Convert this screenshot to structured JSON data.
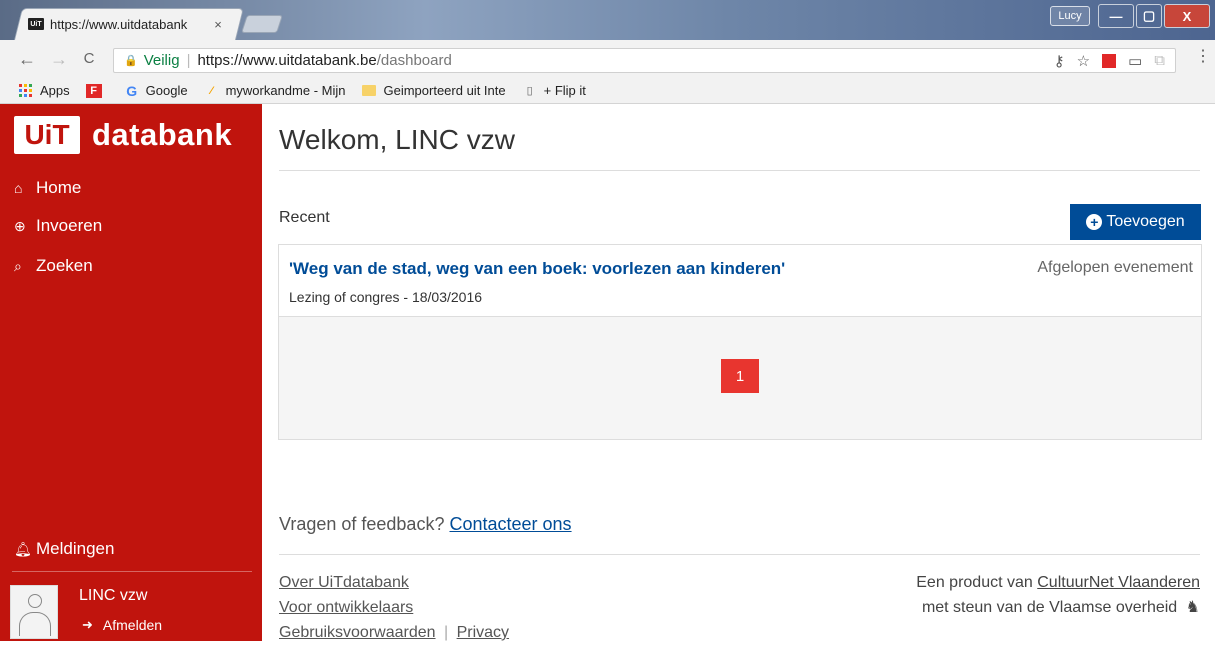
{
  "browser": {
    "tab_title": "https://www.uitdatabank",
    "tab_close": "×",
    "user_button": "Lucy",
    "window": {
      "minimize": "—",
      "maximize": "▢",
      "close": "X"
    },
    "nav": {
      "back": "←",
      "forward": "→",
      "reload": "C"
    },
    "omnibox": {
      "secure_label": "Veilig",
      "separator": "|",
      "url_host": "https://www.uitdatabank.be",
      "url_path": "/dashboard"
    },
    "menu": "⋮",
    "bookmarks": [
      {
        "label": "Apps",
        "icon": "apps-grid-icon"
      },
      {
        "label": "",
        "icon": "flipboard-icon"
      },
      {
        "label": "Google",
        "icon": "google-icon"
      },
      {
        "label": "myworkandme - Mijn",
        "icon": "myworkandme-icon"
      },
      {
        "label": "Geimporteerd uit Inte",
        "icon": "folder-icon"
      },
      {
        "label": "+ Flip it",
        "icon": "page-icon"
      }
    ]
  },
  "sidebar": {
    "logo_box": "UiT",
    "logo_text": "databank",
    "items": [
      {
        "label": "Home",
        "icon": "home-icon"
      },
      {
        "label": "Invoeren",
        "icon": "plus-circle-icon"
      },
      {
        "label": "Zoeken",
        "icon": "search-icon"
      }
    ],
    "notifications": {
      "label": "Meldingen",
      "icon": "bell-icon"
    },
    "user": {
      "name": "LINC vzw",
      "logout": "Afmelden"
    }
  },
  "main": {
    "welcome": "Welkom, LINC vzw",
    "recent_label": "Recent",
    "add_button": "Toevoegen",
    "events": [
      {
        "title": "'Weg van de stad, weg van een boek: voorlezen aan kinderen'",
        "meta": "Lezing of congres - 18/03/2016",
        "status": "Afgelopen evenement"
      }
    ],
    "pagination": {
      "current": "1"
    },
    "feedback": {
      "text": "Vragen of feedback?",
      "link": "Contacteer ons"
    },
    "footer": {
      "links": [
        "Over UiTdatabank",
        "Voor ontwikkelaars",
        "Gebruiksvoorwaarden",
        "Privacy"
      ],
      "divider": "|",
      "product_text": "Een product van",
      "product_link": "CultuurNet Vlaanderen",
      "support_text": "met steun van de Vlaamse overheid"
    }
  },
  "colors": {
    "sidebar": "#c0140d",
    "primary": "#004c97",
    "pagination": "#e8352f"
  }
}
